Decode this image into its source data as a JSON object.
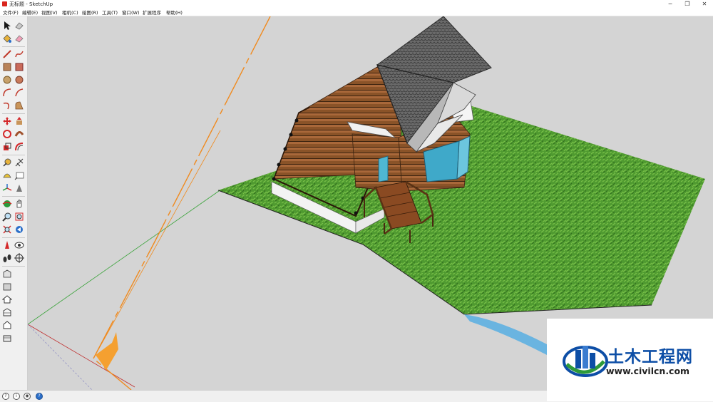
{
  "window": {
    "title": "无标题 - SketchUp",
    "minimize": "─",
    "restore": "❐",
    "close": "✕"
  },
  "menu": [
    {
      "label": "文件(F)"
    },
    {
      "label": "编辑(E)"
    },
    {
      "label": "视图(V)"
    },
    {
      "label": "相机(C)"
    },
    {
      "label": "绘图(R)"
    },
    {
      "label": "工具(T)"
    },
    {
      "label": "窗口(W)"
    },
    {
      "label": "扩展程序"
    },
    {
      "label": "帮助(H)"
    }
  ],
  "tools": [
    "select-tool",
    "eraser-tool-alt",
    "paint-bucket-tool",
    "eraser-tool",
    "line-tool",
    "freehand-tool",
    "rectangle-tool",
    "rotated-rectangle-tool",
    "circle-tool",
    "polygon-tool",
    "arc-tool",
    "pie-tool",
    "two-point-arc-tool",
    "three-point-arc-tool",
    "move-tool",
    "push-pull-tool",
    "rotate-tool",
    "follow-me-tool",
    "scale-tool",
    "offset-tool",
    "tape-measure-tool",
    "dimension-tool",
    "protractor-tool",
    "text-tool",
    "axes-tool",
    "3d-text-tool",
    "orbit-tool",
    "pan-tool",
    "zoom-tool",
    "zoom-window-tool",
    "zoom-extents-tool",
    "previous-view-tool",
    "position-camera-tool",
    "look-around-tool",
    "walk-tool",
    "section-plane-tool",
    "warehouse-icon",
    "extension-icon",
    "home-view-icon",
    "top-view-icon",
    "front-view-icon",
    "right-view-icon"
  ],
  "status": {
    "icons": [
      "geo-location-icon",
      "credits-icon",
      "user-icon",
      "help-icon"
    ],
    "labels": [
      "?",
      "i",
      "◉",
      "?"
    ]
  },
  "watermark": {
    "title": "土木工程网",
    "url": "www.civilcn.com"
  }
}
